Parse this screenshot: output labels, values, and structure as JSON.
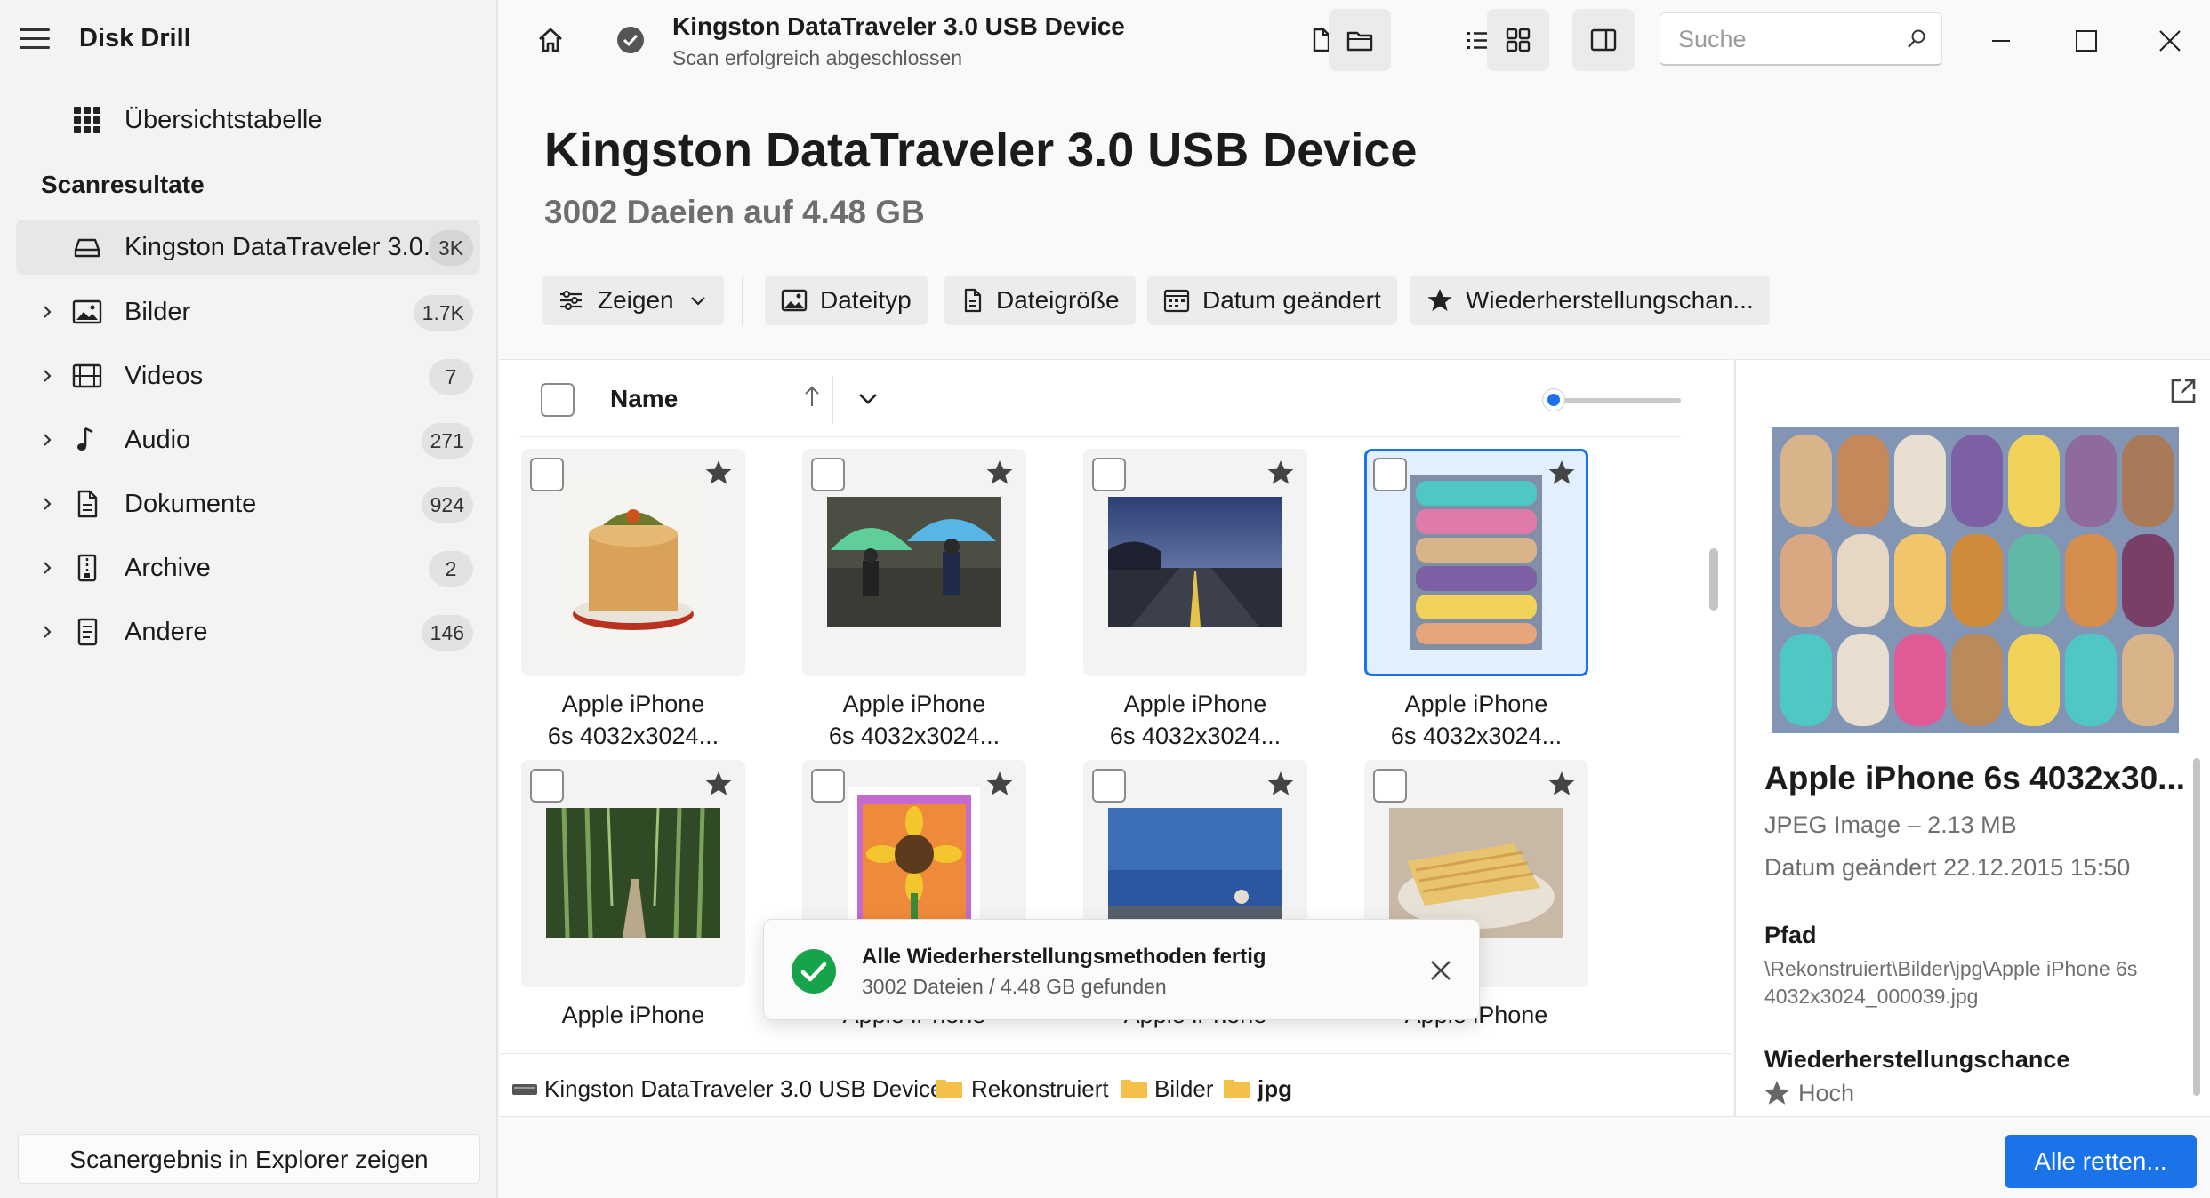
{
  "app": {
    "title": "Disk Drill"
  },
  "sidebar": {
    "overview": {
      "label": "Übersichtstabelle"
    },
    "section_title": "Scanresultate",
    "device": {
      "label": "Kingston DataTraveler 3.0...",
      "count": "3K"
    },
    "items": [
      {
        "label": "Bilder",
        "count": "1.7K",
        "icon": "image-icon"
      },
      {
        "label": "Videos",
        "count": "7",
        "icon": "film-icon"
      },
      {
        "label": "Audio",
        "count": "271",
        "icon": "music-note-icon"
      },
      {
        "label": "Dokumente",
        "count": "924",
        "icon": "document-icon"
      },
      {
        "label": "Archive",
        "count": "2",
        "icon": "archive-icon"
      },
      {
        "label": "Andere",
        "count": "146",
        "icon": "other-file-icon"
      }
    ],
    "explorer_button": "Scanergebnis in Explorer zeigen"
  },
  "topbar": {
    "device_title": "Kingston DataTraveler 3.0 USB Device",
    "status": "Scan erfolgreich abgeschlossen",
    "search_placeholder": "Suche"
  },
  "header": {
    "title": "Kingston DataTraveler 3.0 USB Device",
    "subtitle": "3002 Daeien auf 4.48 GB"
  },
  "filters": {
    "show": "Zeigen",
    "file_type": "Dateityp",
    "file_size": "Dateigröße",
    "date_changed": "Datum geändert",
    "recovery_chance": "Wiederherstellungschan..."
  },
  "list": {
    "column_name": "Name",
    "zoom": 0.0,
    "files": [
      {
        "cap1": "Apple iPhone",
        "cap2": "6s 4032x3024...",
        "selected": false
      },
      {
        "cap1": "Apple iPhone",
        "cap2": "6s 4032x3024...",
        "selected": false
      },
      {
        "cap1": "Apple iPhone",
        "cap2": "6s 4032x3024...",
        "selected": false
      },
      {
        "cap1": "Apple iPhone",
        "cap2": "6s 4032x3024...",
        "selected": true
      },
      {
        "cap1": "Apple iPhone",
        "cap2": "",
        "selected": false
      },
      {
        "cap1": "Apple iPhone",
        "cap2": "",
        "selected": false
      },
      {
        "cap1": "Apple iPhone",
        "cap2": "",
        "selected": false
      },
      {
        "cap1": "Apple iPhone",
        "cap2": "",
        "selected": false
      }
    ]
  },
  "breadcrumb": {
    "device": "Kingston DataTraveler 3.0 USB Device",
    "folder1": "Rekonstruiert",
    "folder2": "Bilder",
    "folder3": "jpg"
  },
  "toast": {
    "title": "Alle Wiederherstellungsmethoden fertig",
    "subtitle": "3002 Dateien / 4.48 GB gefunden"
  },
  "details": {
    "name": "Apple iPhone 6s 4032x30...",
    "type": "JPEG Image – 2.13 MB",
    "date": "Datum geändert 22.12.2015 15:50",
    "path_label": "Pfad",
    "path": "\\Rekonstruiert\\Bilder\\jpg\\Apple iPhone 6s 4032x3024_000039.jpg",
    "chance_label": "Wiederherstellungschance",
    "chance": "Hoch"
  },
  "footer": {
    "recover_button": "Alle retten..."
  },
  "colors": {
    "accent": "#1a73e8",
    "success": "#16a34a"
  }
}
